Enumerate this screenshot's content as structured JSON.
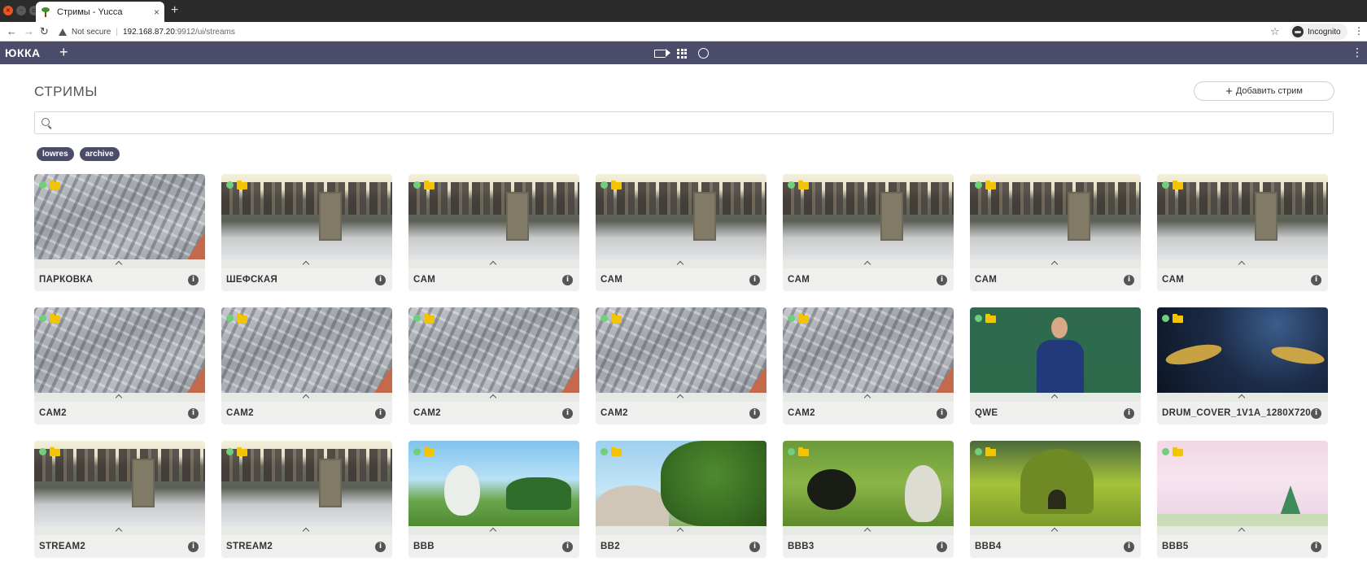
{
  "browser": {
    "tab_title": "Стримы - Yucca",
    "not_secure": "Not secure",
    "url_host": "192.168.87.20",
    "url_port_path": ":9912/ui/streams",
    "incognito_label": "Incognito"
  },
  "app": {
    "logo": "ЮККА",
    "page_title": "СТРИМЫ",
    "add_stream_label": "Добавить стрим",
    "search": {
      "value": "",
      "placeholder": ""
    },
    "tags": [
      "lowres",
      "archive"
    ]
  },
  "colors": {
    "header_bg": "#4b4c69",
    "status_online": "#6fcf7a",
    "folder": "#f2c500",
    "card_bg": "#eff0ee"
  },
  "streams": [
    {
      "name": "ПАРКОВКА",
      "scene": "park"
    },
    {
      "name": "ШЕФСКАЯ",
      "scene": "city"
    },
    {
      "name": "CAM",
      "scene": "city"
    },
    {
      "name": "CAM",
      "scene": "city"
    },
    {
      "name": "CAM",
      "scene": "city"
    },
    {
      "name": "CAM",
      "scene": "city"
    },
    {
      "name": "CAM",
      "scene": "city"
    },
    {
      "name": "CAM2",
      "scene": "park"
    },
    {
      "name": "CAM2",
      "scene": "park"
    },
    {
      "name": "CAM2",
      "scene": "park"
    },
    {
      "name": "CAM2",
      "scene": "park"
    },
    {
      "name": "CAM2",
      "scene": "park"
    },
    {
      "name": "QWE",
      "scene": "classroom"
    },
    {
      "name": "DRUM_COVER_1V1A_1280X720",
      "scene": "drums"
    },
    {
      "name": "STREAM2",
      "scene": "city"
    },
    {
      "name": "STREAM2",
      "scene": "city"
    },
    {
      "name": "BBB",
      "scene": "bbb1"
    },
    {
      "name": "BB2",
      "scene": "bbb2"
    },
    {
      "name": "BBB3",
      "scene": "bbb3"
    },
    {
      "name": "BBB4",
      "scene": "bbb4"
    },
    {
      "name": "BBB5",
      "scene": "bbb5"
    }
  ]
}
